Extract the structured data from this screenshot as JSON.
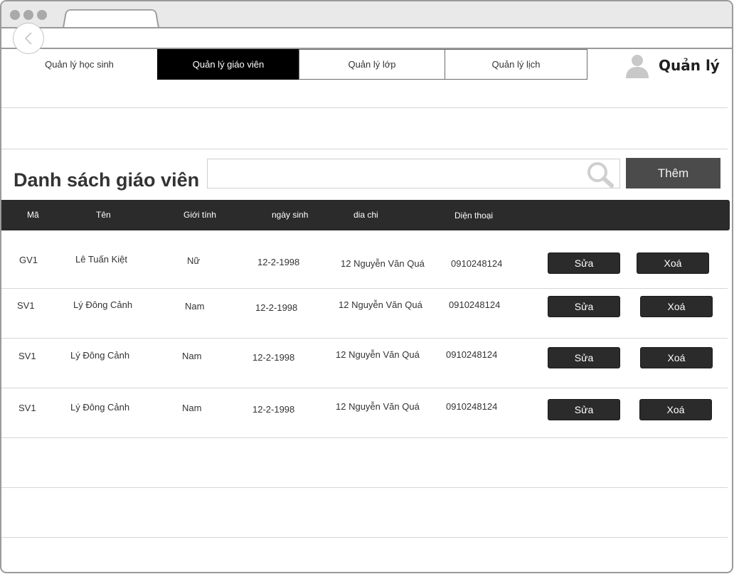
{
  "nav": {
    "tabs": [
      {
        "label": "Quản lý học sinh"
      },
      {
        "label": "Quản lý giáo viên"
      },
      {
        "label": "Quản lý lớp"
      },
      {
        "label": "Quản lý lịch"
      }
    ],
    "active_tab": "Quản lý giáo viên"
  },
  "user": {
    "name": "Quản lý",
    "icon": "user-avatar-icon"
  },
  "page": {
    "title": "Danh sách giáo viên"
  },
  "search": {
    "value": "",
    "placeholder": "",
    "icon": "search-icon"
  },
  "actions": {
    "add_label": "Thêm"
  },
  "table": {
    "columns": [
      "Mã",
      "Tên",
      "Giới tính",
      "ngày sinh",
      "dia chi",
      "Diện thoại"
    ],
    "rows": [
      {
        "ma": "GV1",
        "ten": "Lê Tuấn Kiệt",
        "gioi_tinh": "Nữ",
        "ngay_sinh": "12-2-1998",
        "dia_chi": "12 Nguyễn Văn Quá",
        "dien_thoai": "0910248124",
        "edit": "Sửa",
        "delete": "Xoá"
      },
      {
        "ma": "SV1",
        "ten": "Lý Đông Cảnh",
        "gioi_tinh": "Nam",
        "ngay_sinh": "12-2-1998",
        "dia_chi": "12 Nguyễn Văn Quá",
        "dien_thoai": "0910248124",
        "edit": "Sửa",
        "delete": "Xoá"
      },
      {
        "ma": "SV1",
        "ten": "Lý Đông Cảnh",
        "gioi_tinh": "Nam",
        "ngay_sinh": "12-2-1998",
        "dia_chi": "12 Nguyễn Văn Quá",
        "dien_thoai": "0910248124",
        "edit": "Sửa",
        "delete": "Xoá"
      },
      {
        "ma": "SV1",
        "ten": "Lý Đông Cảnh",
        "gioi_tinh": "Nam",
        "ngay_sinh": "12-2-1998",
        "dia_chi": "12 Nguyễn Văn Quá",
        "dien_thoai": "0910248124",
        "edit": "Sửa",
        "delete": "Xoá"
      }
    ]
  },
  "colors": {
    "header_bg": "#2b2b2b",
    "active_tab_bg": "#000000",
    "add_button_bg": "#4b4b4b"
  }
}
